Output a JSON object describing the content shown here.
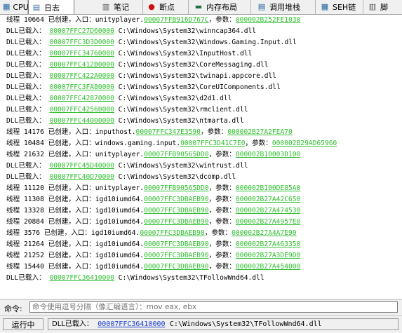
{
  "tabs": [
    {
      "label": "CPU",
      "icon": "cpu-icon",
      "glyph": "▦",
      "color": "#2060a0",
      "active": false
    },
    {
      "label": "日志",
      "icon": "log-icon",
      "glyph": "▤",
      "color": "#3a6ea5",
      "active": true
    },
    {
      "label": "笔记",
      "icon": "notes-icon",
      "glyph": "▥",
      "color": "#555555",
      "active": false
    },
    {
      "label": "断点",
      "icon": "breakpoint-icon",
      "glyph": "●",
      "color": "#d01010",
      "active": false
    },
    {
      "label": "内存布局",
      "icon": "memory-map-icon",
      "glyph": "▬",
      "color": "#207040",
      "active": false
    },
    {
      "label": "调用堆栈",
      "icon": "call-stack-icon",
      "glyph": "▤",
      "color": "#2060a0",
      "active": false
    },
    {
      "label": "SEH链",
      "icon": "seh-chain-icon",
      "glyph": "▦",
      "color": "#2060a0",
      "active": false
    },
    {
      "label": "脚",
      "icon": "script-icon",
      "glyph": "▥",
      "color": "#555555",
      "active": false
    }
  ],
  "log_lines": [
    [
      {
        "t": "线程 10664 已创建，入口：unityplayer."
      },
      {
        "a": "00007FFB916D767C"
      },
      {
        "t": "，参数："
      },
      {
        "a": "000002B252FE1030"
      }
    ],
    [
      {
        "t": "DLL已载入： "
      },
      {
        "a": "00007FFC27D60000"
      },
      {
        "t": " C:\\Windows\\System32\\winncap364.dll"
      }
    ],
    [
      {
        "t": "DLL已载入： "
      },
      {
        "a": "00007FFC3D3D0000"
      },
      {
        "t": " C:\\Windows\\System32\\Windows.Gaming.Input.dll"
      }
    ],
    [
      {
        "t": "DLL已载入： "
      },
      {
        "a": "00007FFC34760000"
      },
      {
        "t": " C:\\Windows\\System32\\InputHost.dll"
      }
    ],
    [
      {
        "t": "DLL已载入： "
      },
      {
        "a": "00007FFC412B0000"
      },
      {
        "t": " C:\\Windows\\System32\\CoreMessaging.dll"
      }
    ],
    [
      {
        "t": "DLL已载入： "
      },
      {
        "a": "00007FFC422A0000"
      },
      {
        "t": " C:\\Windows\\System32\\twinapi.appcore.dll"
      }
    ],
    [
      {
        "t": "DLL已载入： "
      },
      {
        "a": "00007FFC3FA80000"
      },
      {
        "t": " C:\\Windows\\System32\\CoreUIComponents.dll"
      }
    ],
    [
      {
        "t": "DLL已载入： "
      },
      {
        "a": "00007FFC42870000"
      },
      {
        "t": " C:\\Windows\\System32\\d2d1.dll"
      }
    ],
    [
      {
        "t": "DLL已载入： "
      },
      {
        "a": "00007FFC42560000"
      },
      {
        "t": " C:\\Windows\\System32\\rmclient.dll"
      }
    ],
    [
      {
        "t": "DLL已载入： "
      },
      {
        "a": "00007FFC44000000"
      },
      {
        "t": " C:\\Windows\\System32\\ntmarta.dll"
      }
    ],
    [
      {
        "t": "线程 14176 已创建，入口：inputhost."
      },
      {
        "a": "00007FFC347E3590"
      },
      {
        "t": "，参数："
      },
      {
        "a": "000002B27A2FEA70"
      }
    ],
    [
      {
        "t": "线程 10484 已创建，入口：windows.gaming.input."
      },
      {
        "a": "00007FFC3D41C7E0"
      },
      {
        "t": "，参数："
      },
      {
        "a": "000002B29AD65960"
      }
    ],
    [
      {
        "t": "线程 21632 已创建，入口：unityplayer."
      },
      {
        "a": "00007FFB90565DD0"
      },
      {
        "t": "，参数："
      },
      {
        "a": "000002B10003D100"
      }
    ],
    [
      {
        "t": "DLL已载入： "
      },
      {
        "a": "00007FFC45D40000"
      },
      {
        "t": " C:\\Windows\\System32\\wintrust.dll"
      }
    ],
    [
      {
        "t": "DLL已载入： "
      },
      {
        "a": "00007FFC40D70000"
      },
      {
        "t": " C:\\Windows\\System32\\dcomp.dll"
      }
    ],
    [
      {
        "t": "线程 11120 已创建，入口：unityplayer."
      },
      {
        "a": "00007FFB90565DD0"
      },
      {
        "t": "，参数："
      },
      {
        "a": "000002B100DE85A0"
      }
    ],
    [
      {
        "t": "线程 11308 已创建，入口：igd10iumd64."
      },
      {
        "a": "00007FFC3DBAEB90"
      },
      {
        "t": "，参数："
      },
      {
        "a": "000002B27A42C650"
      }
    ],
    [
      {
        "t": "线程 13328 已创建，入口：igd10iumd64."
      },
      {
        "a": "00007FFC3DBAEB90"
      },
      {
        "t": "，参数："
      },
      {
        "a": "000002B27A474530"
      }
    ],
    [
      {
        "t": "线程 20884 已创建，入口：igd10iumd64."
      },
      {
        "a": "00007FFC3DBAEB90"
      },
      {
        "t": "，参数："
      },
      {
        "a": "000002B27A4957E0"
      }
    ],
    [
      {
        "t": "线程 3576 已创建，入口：igd10iumd64."
      },
      {
        "a": "00007FFC3DBAEB90"
      },
      {
        "t": "，参数："
      },
      {
        "a": "000002B27A4A7E90"
      }
    ],
    [
      {
        "t": "线程 21264 已创建，入口：igd10iumd64."
      },
      {
        "a": "00007FFC3DBAEB90"
      },
      {
        "t": "，参数："
      },
      {
        "a": "000002B27A463350"
      }
    ],
    [
      {
        "t": "线程 21252 已创建，入口：igd10iumd64."
      },
      {
        "a": "00007FFC3DBAEB90"
      },
      {
        "t": "，参数："
      },
      {
        "a": "000002B27A3DE9D0"
      }
    ],
    [
      {
        "t": "线程 15440 已创建，入口：igd10iumd64."
      },
      {
        "a": "00007FFC3DBAEB90"
      },
      {
        "t": "，参数："
      },
      {
        "a": "000002B27A454000"
      }
    ],
    [
      {
        "t": "DLL已载入： "
      },
      {
        "a": "00007FFC36410000"
      },
      {
        "t": " C:\\Windows\\System32\\TFollowWnd64.dll"
      }
    ]
  ],
  "command": {
    "label": "命令:",
    "placeholder": "命令使用逗号分隔（像汇编语言）：mov eax, ebx"
  },
  "status": {
    "state": "运行中",
    "prefix": "DLL已载入：",
    "address": "00007FFC36410000",
    "path": "C:\\Windows\\System32\\TFollowWnd64.dll"
  },
  "colors": {
    "address_link": "#2fbf2f",
    "status_link": "#1f3fd0"
  }
}
